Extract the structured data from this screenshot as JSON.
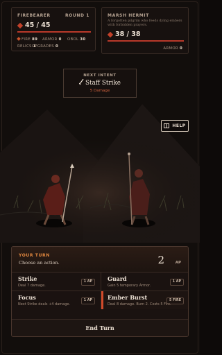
{
  "player": {
    "name": "FIREBEARER",
    "round": "ROUND 1",
    "hp": "45 / 45",
    "hp_fraction": 1.0,
    "stats": [
      {
        "label": "FIRE",
        "value": "89"
      },
      {
        "label": "ARMOR",
        "value": "0"
      },
      {
        "label": "OBOL",
        "value": "30"
      }
    ],
    "stats2": [
      {
        "label": "RELICS",
        "value": "1"
      },
      {
        "label": "UPGRADES",
        "value": "0"
      }
    ]
  },
  "enemy": {
    "name": "MARSH HERMIT",
    "description": "A forgotten pilgrim who feeds dying embers with forbidden prayers.",
    "hp": "38 / 38",
    "hp_fraction": 1.0,
    "armor_label": "ARMOR",
    "armor_value": "0"
  },
  "intent": {
    "label": "NEXT INTENT",
    "name": "Staff Strike",
    "damage": "5 Damage"
  },
  "help": {
    "label": "HELP"
  },
  "turn": {
    "title": "YOUR TURN",
    "subtitle": "Choose an action.",
    "ap_value": "2",
    "ap_label": "AP"
  },
  "actions": [
    {
      "name": "Strike",
      "desc": "Deal 7 damage.",
      "cost": "1 AP"
    },
    {
      "name": "Guard",
      "desc": "Gain 5 temporary Armor.",
      "cost": "1 AP"
    },
    {
      "name": "Focus",
      "desc": "Next Strike deals +4 damage.",
      "cost": "1 AP"
    },
    {
      "name": "Ember Burst",
      "desc": "Deal 8 damage. Burn 2. Costs 5 Fire.",
      "cost": "5 FIRE"
    }
  ],
  "end_turn": {
    "label": "End Turn"
  },
  "colors": {
    "accent": "#e1873f",
    "health": "#b9392a",
    "ember": "#d24a2a"
  }
}
